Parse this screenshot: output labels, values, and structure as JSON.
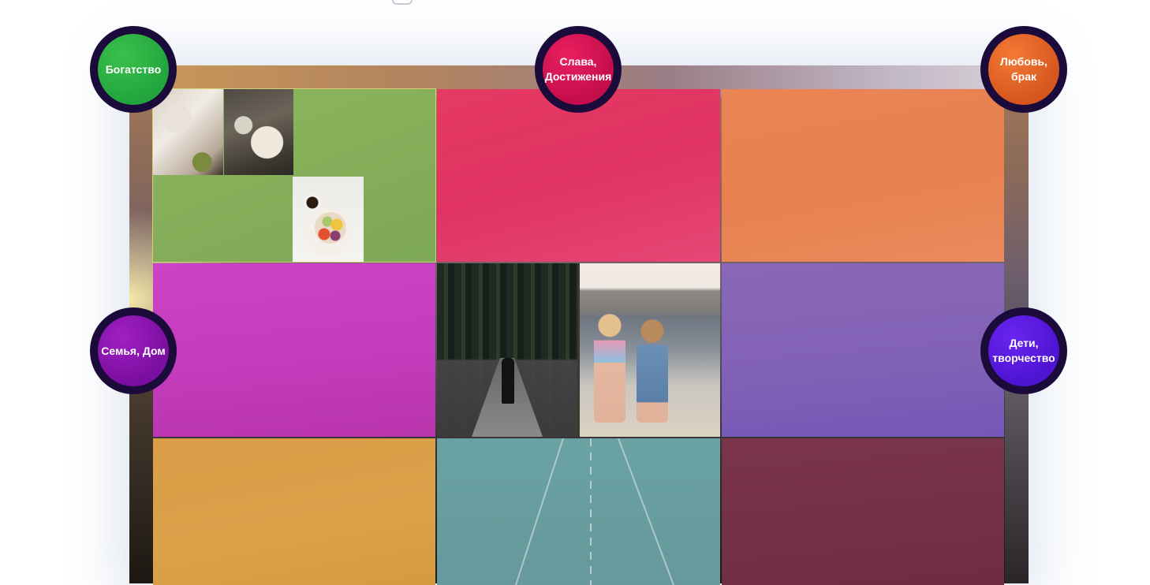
{
  "sectors": {
    "wealth": "Богатство",
    "fame_line1": "Слава,",
    "fame_line2": "Достижения",
    "love_line1": "Любовь,",
    "love_line2": "брак",
    "family": "Семья, Дом",
    "children_line1": "Дети,",
    "children_line2": "творчество"
  },
  "colors": {
    "wealth": "#8ab65e",
    "fame": "#e23862",
    "love": "#e8804f",
    "family": "#c43cbc",
    "children": "#8262b6",
    "knowledge": "#dba24a",
    "career": "#66999b",
    "helpers": "#743047",
    "badge_ring": "#1a0b3b"
  },
  "icons": {
    "top": "collapse-tab-icon"
  }
}
